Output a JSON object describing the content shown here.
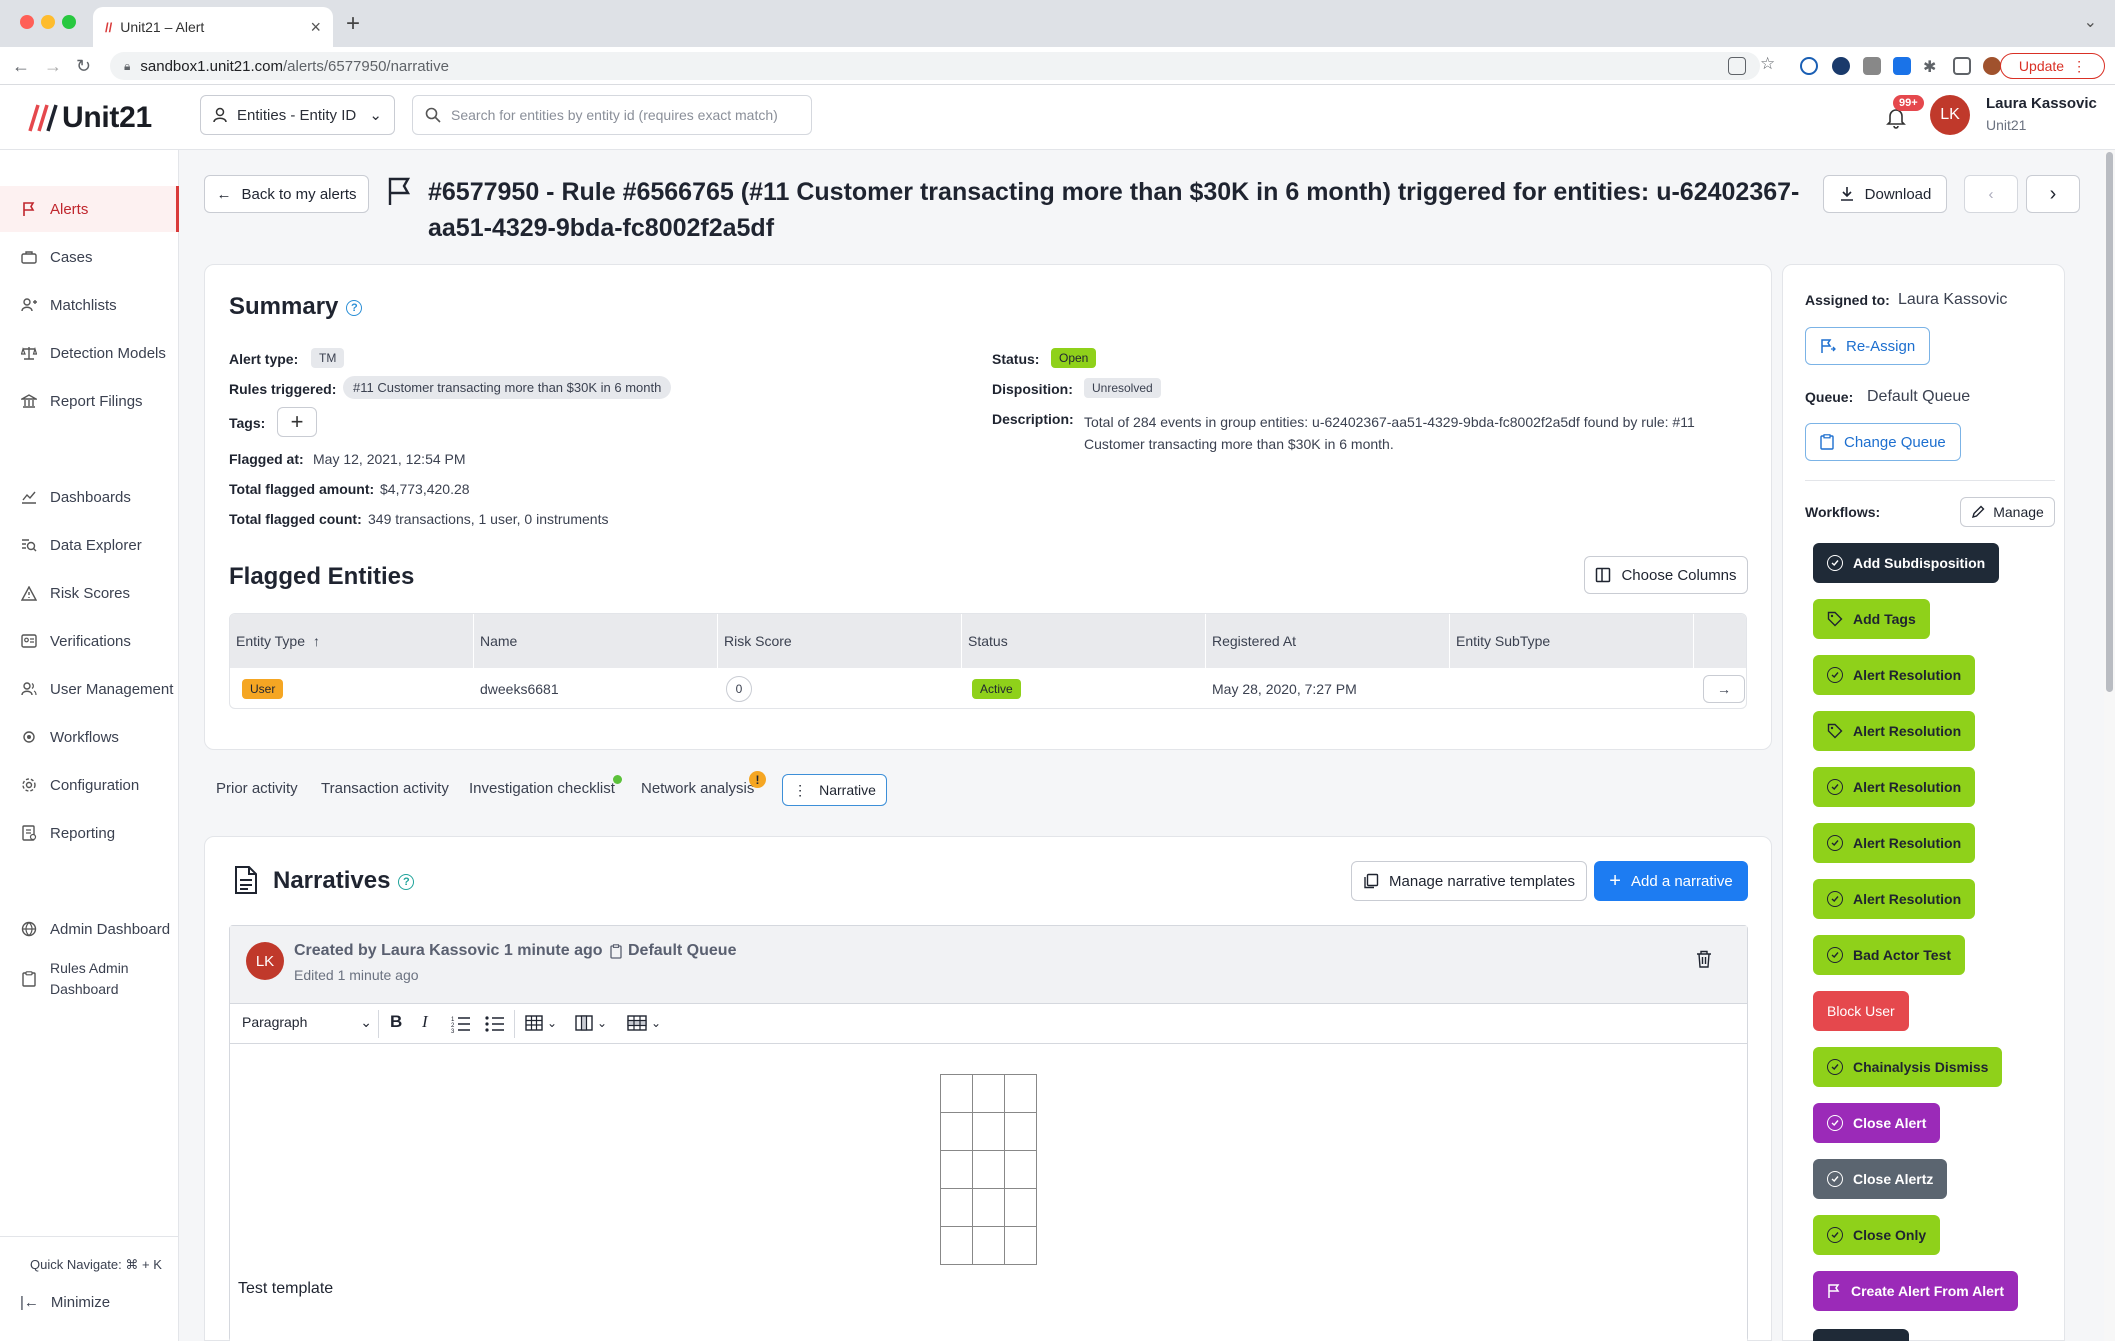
{
  "browser": {
    "tab_title": "Unit21 – Alert",
    "url_host": "sandbox1.unit21.com",
    "url_path": "/alerts/6577950/narrative",
    "update_label": "Update"
  },
  "header": {
    "logo_text": "Unit21",
    "entity_selector": "Entities - Entity ID",
    "search_placeholder": "Search for entities by entity id (requires exact match)",
    "notif_count": "99+",
    "user_initials": "LK",
    "user_name": "Laura Kassovic",
    "user_org": "Unit21"
  },
  "sidebar": {
    "items": [
      {
        "label": "Alerts",
        "icon": "flag-icon"
      },
      {
        "label": "Cases",
        "icon": "briefcase-icon"
      },
      {
        "label": "Matchlists",
        "icon": "user-plus-icon"
      },
      {
        "label": "Detection Models",
        "icon": "scale-icon"
      },
      {
        "label": "Report Filings",
        "icon": "bank-icon"
      },
      {
        "label": "Dashboards",
        "icon": "chart-line-icon"
      },
      {
        "label": "Data Explorer",
        "icon": "data-search-icon"
      },
      {
        "label": "Risk Scores",
        "icon": "warning-icon"
      },
      {
        "label": "Verifications",
        "icon": "id-card-icon"
      },
      {
        "label": "User Management",
        "icon": "users-icon"
      },
      {
        "label": "Workflows",
        "icon": "workflow-icon"
      },
      {
        "label": "Configuration",
        "icon": "gear-icon"
      },
      {
        "label": "Reporting",
        "icon": "report-icon"
      },
      {
        "label": "Admin Dashboard",
        "icon": "globe-icon"
      },
      {
        "label": "Rules Admin",
        "label2": "Dashboard",
        "icon": "clipboard-icon"
      }
    ],
    "quick_nav": "Quick Navigate: ⌘ + K",
    "minimize": "Minimize"
  },
  "page": {
    "back_label": "Back to my alerts",
    "title": "#6577950 - Rule #6566765 (#11 Customer transacting more than $30K in 6 month) triggered for entities: u-62402367-aa51-4329-9bda-fc8002f2a5df",
    "download_label": "Download"
  },
  "summary": {
    "heading": "Summary",
    "alert_type_label": "Alert type:",
    "alert_type": "TM",
    "rules_label": "Rules triggered:",
    "rules": "#11 Customer transacting more than $30K in 6 month",
    "tags_label": "Tags:",
    "flagged_at_label": "Flagged at:",
    "flagged_at": "May 12, 2021, 12:54 PM",
    "amount_label": "Total flagged amount:",
    "amount": "$4,773,420.28",
    "count_label": "Total flagged count:",
    "count": "349 transactions, 1 user, 0 instruments",
    "status_label": "Status:",
    "status": "Open",
    "disposition_label": "Disposition:",
    "disposition": "Unresolved",
    "description_label": "Description:",
    "description_line1": "Total of 284 events in group entities: u-62402367-aa51-4329-9bda-fc8002f2a5df found by rule: #11",
    "description_line2": "Customer transacting more than $30K in 6 month."
  },
  "flagged": {
    "heading": "Flagged Entities",
    "choose_columns": "Choose Columns",
    "columns": [
      "Entity Type",
      "Name",
      "Risk Score",
      "Status",
      "Registered At",
      "Entity SubType"
    ],
    "row": {
      "type": "User",
      "name": "dweeks6681",
      "risk": "0",
      "status": "Active",
      "registered": "May 28, 2020, 7:27 PM",
      "subtype": ""
    }
  },
  "tabs": [
    "Prior activity",
    "Transaction activity",
    "Investigation checklist",
    "Network analysis",
    "Narrative"
  ],
  "narratives": {
    "heading": "Narratives",
    "manage_templates": "Manage narrative templates",
    "add_narrative": "Add a narrative",
    "author_initials": "LK",
    "created_by": "Created by Laura Kassovic 1 minute ago",
    "edited": "Edited 1 minute ago",
    "queue": "Default Queue",
    "paragraph_select": "Paragraph",
    "body_text": "Test template"
  },
  "right_panel": {
    "assigned_label": "Assigned to:",
    "assigned_to": "Laura Kassovic",
    "reassign": "Re-Assign",
    "queue_label": "Queue:",
    "queue": "Default Queue",
    "change_queue": "Change Queue",
    "workflows_label": "Workflows:",
    "manage": "Manage",
    "workflows": [
      {
        "label": "Add Subdisposition",
        "style": "dark",
        "icon": "check-circle-icon"
      },
      {
        "label": "Add Tags",
        "style": "green",
        "icon": "tag-icon"
      },
      {
        "label": "Alert Resolution",
        "style": "green",
        "icon": "check-circle-icon"
      },
      {
        "label": "Alert Resolution",
        "style": "green",
        "icon": "tag-icon"
      },
      {
        "label": "Alert Resolution",
        "style": "green",
        "icon": "check-circle-icon"
      },
      {
        "label": "Alert Resolution",
        "style": "green",
        "icon": "check-circle-icon"
      },
      {
        "label": "Alert Resolution",
        "style": "green",
        "icon": "check-circle-icon"
      },
      {
        "label": "Bad Actor Test",
        "style": "green",
        "icon": "check-circle-icon"
      },
      {
        "label": "Block User",
        "style": "red",
        "icon": ""
      },
      {
        "label": "Chainalysis Dismiss",
        "style": "green",
        "icon": "check-circle-icon"
      },
      {
        "label": "Close Alert",
        "style": "purple",
        "icon": "check-circle-icon"
      },
      {
        "label": "Close Alertz",
        "style": "gray",
        "icon": "check-circle-icon"
      },
      {
        "label": "Close Only",
        "style": "green",
        "icon": "check-circle-icon"
      },
      {
        "label": "Create Alert From Alert",
        "style": "purple",
        "icon": "flag-icon"
      }
    ]
  },
  "colors": {
    "accent_blue": "#1d7cf2",
    "alert_red": "#d93a3a",
    "workflow_green": "#8fd11a",
    "workflow_purple": "#9b2ab8",
    "workflow_dark": "#1f2a37"
  }
}
